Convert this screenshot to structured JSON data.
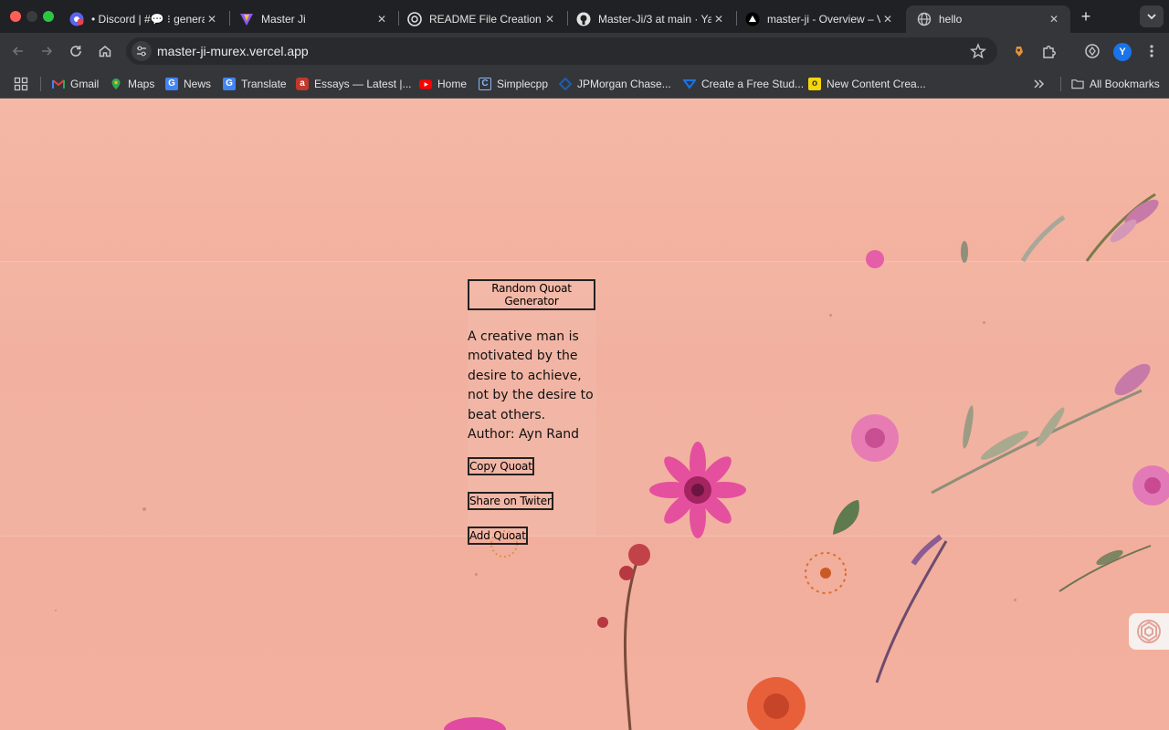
{
  "browser": {
    "tabs": [
      {
        "title": "• Discord | #💬 ⁝ genera",
        "icon": "discord-icon",
        "active": false
      },
      {
        "title": "Master Ji",
        "icon": "vite-icon",
        "active": false
      },
      {
        "title": "README File Creation",
        "icon": "openai-icon",
        "active": false
      },
      {
        "title": "Master-Ji/3 at main · Ya",
        "icon": "github-icon",
        "active": false
      },
      {
        "title": "master-ji - Overview – V",
        "icon": "vercel-icon",
        "active": false
      },
      {
        "title": "hello",
        "icon": "globe-icon",
        "active": true
      }
    ],
    "url": "master-ji-murex.vercel.app",
    "profile_initial": "Y",
    "bookmarks": [
      {
        "label": "Gmail",
        "icon": "gmail-icon"
      },
      {
        "label": "Maps",
        "icon": "maps-icon"
      },
      {
        "label": "News",
        "icon": "news-icon"
      },
      {
        "label": "Translate",
        "icon": "translate-icon"
      },
      {
        "label": "Essays — Latest |...",
        "icon": "essays-icon"
      },
      {
        "label": "Home",
        "icon": "youtube-icon"
      },
      {
        "label": "Simplecpp",
        "icon": "simplecpp-icon"
      },
      {
        "label": "JPMorgan Chase...",
        "icon": "jpmorgan-icon"
      },
      {
        "label": "Create a Free Stud...",
        "icon": "student-icon"
      },
      {
        "label": "New Content Crea...",
        "icon": "content-icon"
      }
    ],
    "all_bookmarks_label": "All Bookmarks"
  },
  "app": {
    "generate_label": "Random Quoat Generator",
    "quote_text": "A creative man is motivated by the desire to achieve, not by the desire to beat others. Author: Ayn Rand",
    "copy_label": "Copy Quoat",
    "share_label": "Share on Twiter",
    "add_label": "Add Quoat"
  },
  "colors": {
    "page_background": "#f3b09e",
    "browser_frame": "#202124",
    "toolbar": "#35363a"
  }
}
